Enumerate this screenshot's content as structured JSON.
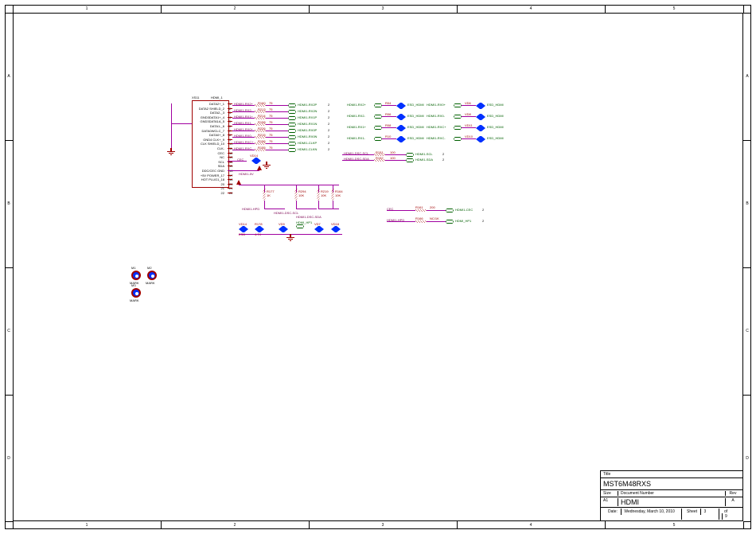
{
  "titleblock": {
    "title_label": "Title",
    "title": "MST6M48RXS",
    "size_label": "Size",
    "size": "A1",
    "docnum_label": "Document Number",
    "docnum": "HDMI",
    "rev_label": "Rev",
    "rev": "A",
    "date_label": "Date:",
    "date": "Wednesday, March 10, 2010",
    "sheet_label": "Sheet",
    "sheet": "3",
    "of_label": "of",
    "of": "9"
  },
  "ruler": {
    "top": [
      "1",
      "2",
      "3",
      "4",
      "5"
    ],
    "bottom": [
      "1",
      "2",
      "3",
      "4",
      "5"
    ],
    "left": [
      "A",
      "B",
      "C",
      "D"
    ],
    "right": [
      "D",
      "C",
      "B",
      "A"
    ]
  },
  "connector": {
    "refdes": "XS11",
    "part": "HDMI_1",
    "pins": [
      {
        "n": "1",
        "name": "DATA2+_1"
      },
      {
        "n": "2",
        "name": "DATA2 SHIELD_2"
      },
      {
        "n": "3",
        "name": "DATA2-_3"
      },
      {
        "n": "4",
        "name": "GND3DATA1+_4"
      },
      {
        "n": "5",
        "name": "GND3DATA1A_5"
      },
      {
        "n": "6",
        "name": "DATA1-_6"
      },
      {
        "n": "7",
        "name": "DATA0WCLC_7"
      },
      {
        "n": "8",
        "name": "DATA0+_8"
      },
      {
        "n": "9",
        "name": "GND4   CLK+_9"
      },
      {
        "n": "10",
        "name": "CLK SHIELD_10"
      },
      {
        "n": "11",
        "name": "CLK-"
      },
      {
        "n": "12",
        "name": "CEC"
      },
      {
        "n": "13",
        "name": "NC"
      },
      {
        "n": "14",
        "name": "SCL"
      },
      {
        "n": "15",
        "name": "SDA"
      },
      {
        "n": "16",
        "name": "DDC/CEC GND"
      },
      {
        "n": "17",
        "name": "+5V POWER_17"
      },
      {
        "n": "18",
        "name": "HOT PLUG1_18"
      },
      {
        "n": "20",
        "name": "20"
      },
      {
        "n": "21",
        "name": "21"
      },
      {
        "n": "22",
        "name": "22"
      }
    ]
  },
  "series_rows": [
    {
      "net": "HDMI1-RX2+",
      "ref": "R160",
      "val": "75",
      "port": "HDMI1-RX2P",
      "pg": "2"
    },
    {
      "net": "HDMI1-RX2-",
      "ref": "R213",
      "val": "75",
      "port": "HDMI1-RX2N",
      "pg": "2"
    },
    {
      "net": "HDMI1-RX1+",
      "ref": "R214",
      "val": "75",
      "port": "HDMI1-RX1P",
      "pg": "2"
    },
    {
      "net": "HDMI1-RX1-",
      "ref": "R158",
      "val": "75",
      "port": "HDMI1-RX1N",
      "pg": "2"
    },
    {
      "net": "HDMI1-RX0+",
      "ref": "R226",
      "val": "75",
      "port": "HDMI1-RX0P",
      "pg": "2"
    },
    {
      "net": "HDMI1-RX0-",
      "ref": "R215",
      "val": "75",
      "port": "HDMI1-RX0N",
      "pg": "2"
    },
    {
      "net": "HDMI1-RXC+",
      "ref": "R156",
      "val": "75",
      "port": "HDMI1-CLKP",
      "pg": "2"
    },
    {
      "net": "HDMI1-RXC-",
      "ref": "R155",
      "val": "75",
      "port": "HDMI1-CLKN",
      "pg": "2"
    }
  ],
  "esd_rows": [
    {
      "net": "HDMI1-RX2+",
      "ref": "R04",
      "esd": "ESD_HDMI",
      "net2": "HDMI1-RX0+",
      "ref2": "VD6",
      "esd2": "ESD_HDMI"
    },
    {
      "net": "HDMI1-RX2-",
      "ref": "R06",
      "esd": "ESD_HDMI",
      "net2": "HDMI1-RX0-",
      "ref2": "VD8",
      "esd2": "ESD_HDMI"
    },
    {
      "net": "HDMI1-RX1+",
      "ref": "R08",
      "esd": "ESD_HDMI",
      "net2": "HDMI1-RXC+",
      "ref2": "VD11",
      "esd2": "ESD_HDMI"
    },
    {
      "net": "HDMI1-RX1-",
      "ref": "R10",
      "esd": "ESD_HDMI",
      "net2": "HDMI1-RXC-",
      "ref2": "VD10",
      "esd2": "ESD_HDMI"
    }
  ],
  "ddc_rows": [
    {
      "net": "HDMI1-DSC-SCL",
      "ref": "R151",
      "val": "100",
      "port": "HDMI1-SCL",
      "pg": "2"
    },
    {
      "net": "HDMI1-DSC-SDA",
      "ref": "R152",
      "val": "100",
      "port": "HDMI1-SDA",
      "pg": "2"
    }
  ],
  "cec_vd": {
    "net": "CEC",
    "vd": "VD14",
    "val": "5V"
  },
  "power": {
    "net": "HDMI1-5V"
  },
  "pulls": [
    {
      "ref": "R177",
      "val": "1K",
      "net": "HDMI1-HPD"
    },
    {
      "ref": "R294",
      "val": "10K",
      "net": "HDMI1-DSC-SCL"
    },
    {
      "ref": "R219",
      "val": "10K",
      "net": "HDMI1-DSC-SDA"
    },
    {
      "ref": "R164",
      "val": "10K",
      "net": ""
    }
  ],
  "bottom_tvs": [
    {
      "ref": "VD14",
      "val": "ESD"
    },
    {
      "ref": "R178",
      "val": "4.7K"
    },
    {
      "ref": "VD9",
      "val": ""
    },
    {
      "ref": "VD7",
      "val": ""
    },
    {
      "ref": "VD18",
      "val": ""
    }
  ],
  "hp_port": {
    "net": "HDMI_HP1",
    "pg": "",
    "ref": "R178",
    "val": "4.7K"
  },
  "side_ports": [
    {
      "net": "CEC",
      "ref": "R161",
      "val": "200",
      "port": "HDMI1-CEC",
      "pg": "2"
    },
    {
      "net": "HDMI1-HPD",
      "ref": "R166",
      "val": "NC/1K",
      "port": "HDMI_HP1",
      "pg": "2"
    }
  ],
  "marks": [
    {
      "ref": "M1",
      "name": "MARK"
    },
    {
      "ref": "M2",
      "name": "MARK"
    },
    {
      "ref": "M3",
      "name": "MARK"
    }
  ]
}
